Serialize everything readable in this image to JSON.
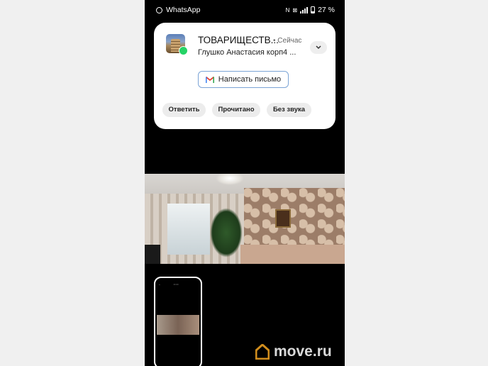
{
  "status_bar": {
    "app": "WhatsApp",
    "battery": "27 %"
  },
  "notification": {
    "title": "ТОВАРИЩЕСТВ...",
    "time": "• Сейчас",
    "message": "Глушко Анастасия корп4 ...",
    "compose_label": "Написать письмо",
    "actions": [
      "Ответить",
      "Прочитано",
      "Без звука"
    ]
  },
  "icons": {
    "whatsapp": "whatsapp-icon",
    "expand": "chevron-down-icon",
    "gmail": "gmail-icon",
    "watermark": "move-house-icon"
  },
  "colors": {
    "watermark_accent": "#f5a623",
    "whatsapp_green": "#25d366",
    "compose_border": "#7ba4d6"
  },
  "watermark": {
    "text": "move.ru"
  }
}
